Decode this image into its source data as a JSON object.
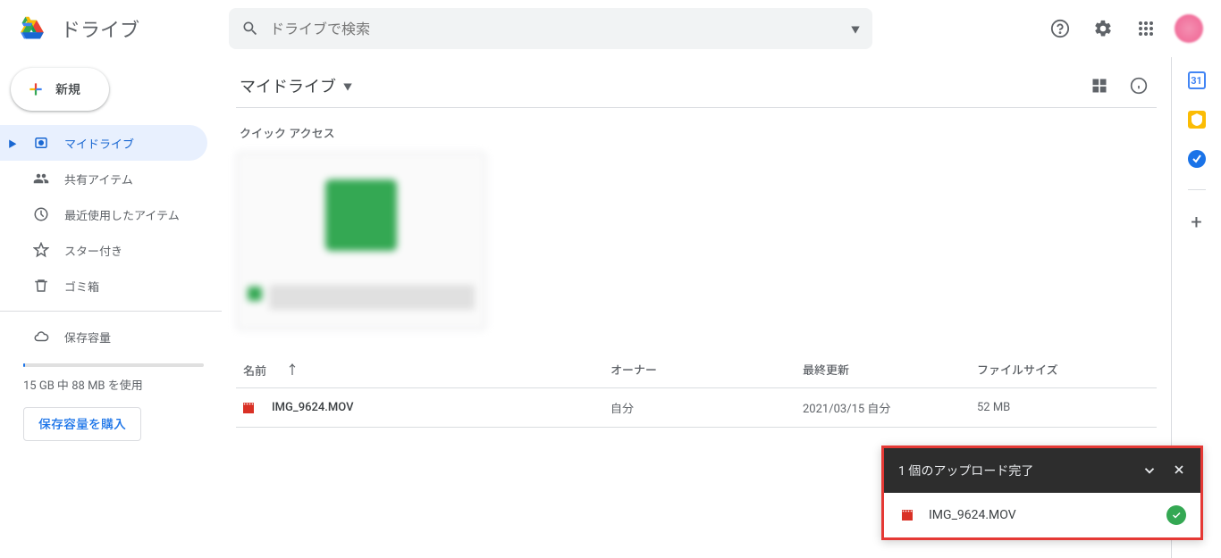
{
  "header": {
    "app_name": "ドライブ",
    "search_placeholder": "ドライブで検索"
  },
  "sidebar": {
    "new_label": "新規",
    "items": [
      {
        "label": "マイドライブ"
      },
      {
        "label": "共有アイテム"
      },
      {
        "label": "最近使用したアイテム"
      },
      {
        "label": "スター付き"
      },
      {
        "label": "ゴミ箱"
      }
    ],
    "storage_label": "保存容量",
    "storage_text": "15 GB 中 88 MB を使用",
    "buy_label": "保存容量を購入"
  },
  "main": {
    "breadcrumb": "マイドライブ",
    "quick_access_title": "クイック アクセス",
    "columns": {
      "name": "名前",
      "owner": "オーナー",
      "modified": "最終更新",
      "size": "ファイルサイズ"
    },
    "files": [
      {
        "name": "IMG_9624.MOV",
        "owner": "自分",
        "modified": "2021/03/15 自分",
        "size": "52 MB"
      }
    ]
  },
  "toast": {
    "title": "1 個のアップロード完了",
    "file": "IMG_9624.MOV"
  }
}
